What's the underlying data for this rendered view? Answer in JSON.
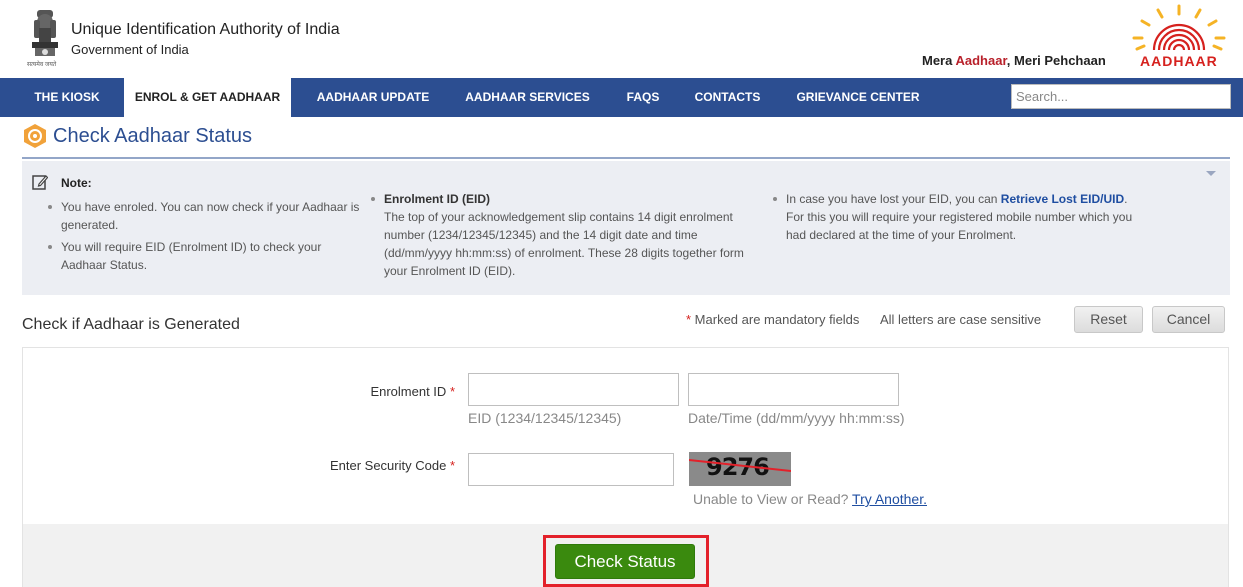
{
  "header": {
    "org_title": "Unique Identification Authority of India",
    "org_subtitle": "Government of India",
    "tagline_prefix": "Mera ",
    "tagline_highlight": "Aadhaar",
    "tagline_suffix": ", Meri Pehchaan",
    "logo_text": "AADHAAR",
    "emblem_caption": "सत्यमेव जयते"
  },
  "nav": {
    "items": [
      {
        "label": "THE KIOSK",
        "active": false
      },
      {
        "label": "ENROL & GET AADHAAR",
        "active": true
      },
      {
        "label": "AADHAAR UPDATE",
        "active": false
      },
      {
        "label": "AADHAAR SERVICES",
        "active": false
      },
      {
        "label": "FAQS",
        "active": false
      },
      {
        "label": "CONTACTS",
        "active": false
      },
      {
        "label": "GRIEVANCE CENTER",
        "active": false
      }
    ],
    "search_placeholder": "Search..."
  },
  "page": {
    "title": "Check Aadhaar Status"
  },
  "note": {
    "heading": "Note:",
    "col1": [
      "You have enroled. You can now check if your Aadhaar is generated.",
      "You will require EID (Enrolment ID) to check your Aadhaar Status."
    ],
    "col2_title": "Enrolment ID (EID)",
    "col2_body": "The top of your acknowledgement slip contains 14 digit enrolment number (1234/12345/12345) and the 14 digit date and time (dd/mm/yyyy hh:mm:ss) of enrolment. These 28 digits together form your Enrolment ID (EID).",
    "col3_prefix": "In case you have lost your EID, you can ",
    "col3_link": "Retrieve Lost EID/UID",
    "col3_suffix": ". For this you will require your registered mobile number which you had declared at the time of your Enrolment."
  },
  "form": {
    "heading": "Check if Aadhaar is Generated",
    "mandatory_star": "*",
    "mandatory_text": " Marked are mandatory fields",
    "case_note": "All letters are case sensitive",
    "reset_label": "Reset",
    "cancel_label": "Cancel",
    "enrolment_label": "Enrolment ID",
    "eid_value": "",
    "eid_hint": "EID (1234/12345/12345)",
    "datetime_value": "",
    "datetime_hint": "Date/Time (dd/mm/yyyy hh:mm:ss)",
    "security_label": "Enter Security Code",
    "security_value": "",
    "captcha_text": "9276",
    "unable_text": "Unable to View or Read? ",
    "try_another": "Try Another.",
    "submit_label": "Check Status"
  },
  "colors": {
    "nav_bg": "#2c4e91",
    "title_blue": "#2c4e91",
    "submit_green": "#3a8a0e",
    "highlight_red": "#e3212a",
    "brand_red": "#d6211e"
  }
}
